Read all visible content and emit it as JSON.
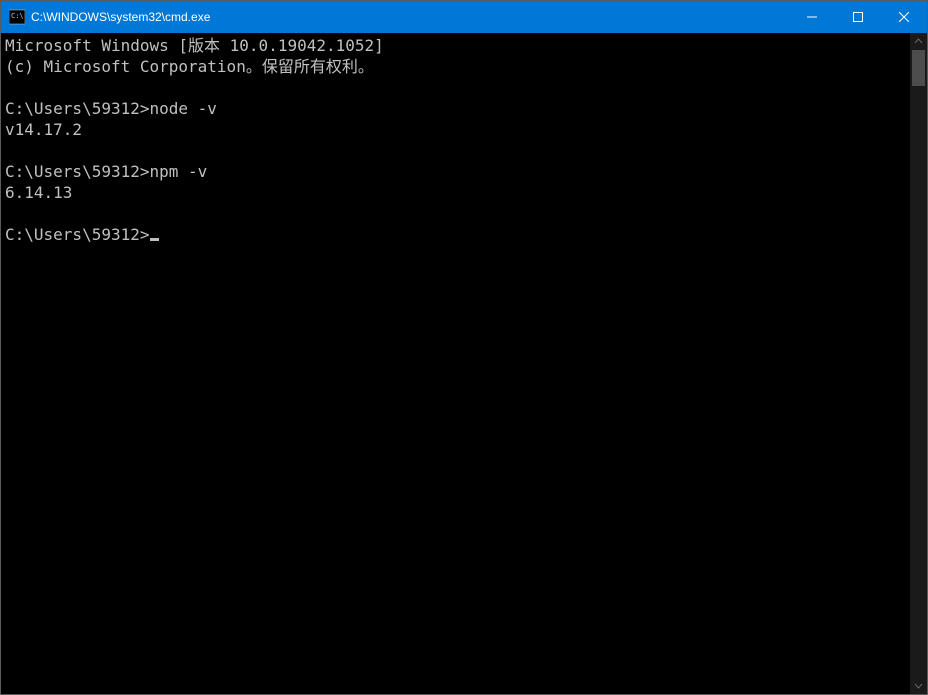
{
  "window": {
    "title": "C:\\WINDOWS\\system32\\cmd.exe"
  },
  "terminal": {
    "header1": "Microsoft Windows [版本 10.0.19042.1052]",
    "header2": "(c) Microsoft Corporation。保留所有权利。",
    "blocks": [
      {
        "prompt": "C:\\Users\\59312>",
        "command": "node -v",
        "output": "v14.17.2"
      },
      {
        "prompt": "C:\\Users\\59312>",
        "command": "npm -v",
        "output": "6.14.13"
      }
    ],
    "current_prompt": "C:\\Users\\59312>"
  }
}
